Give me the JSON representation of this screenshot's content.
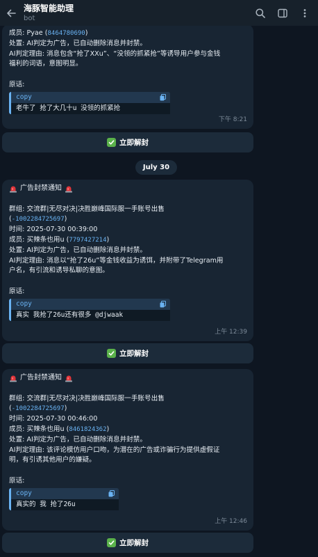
{
  "header": {
    "title": "海豚智能助理",
    "subtitle": "bot"
  },
  "date_separator": "July 30",
  "messages": [
    {
      "lines": {
        "member_label": "成员: Pyae (",
        "member_id": "8464780690",
        "member_suffix": ")",
        "action": "处置: AI判定为广告，已自动删除消息并封禁。",
        "reason_1": "AI判定理由: 消息包含“抢了XXu”、“没领的抓紧抢”等诱导用户参与金钱",
        "reason_2": "福利的词语，意图明显。",
        "original_label": "原话:"
      },
      "code": {
        "lang": "copy",
        "text": "老牛了 抢了大几十u 没领的抓紧抢"
      },
      "time": "下午 8:21"
    },
    {
      "lines": {
        "notice_title": "广告封禁通知",
        "group": "群组: 交流群|无尽对决|决胜巅峰国际服一手账号出售",
        "group_id": "-1002284725697",
        "time_line": "时间: 2025-07-30 00:39:00",
        "member_label": "成员: 买辣条也用u (",
        "member_id": "7797427214",
        "member_suffix": ")",
        "action": "处置: AI判定为广告，已自动删除消息并封禁。",
        "reason_1": "AI判定理由: 消息以“抢了26u”等金钱收益为诱饵，并附带了Telegram用",
        "reason_2": "户名，有引流和诱导私聊的意图。",
        "original_label": "原话:"
      },
      "code": {
        "lang": "copy",
        "text": "真实 我抢了26u还有很多 @djwaak"
      },
      "time": "上午 12:39"
    },
    {
      "lines": {
        "notice_title": "广告封禁通知",
        "group": "群组: 交流群|无尽对决|决胜巅峰国际服一手账号出售",
        "group_id": "-1002284725697",
        "time_line": "时间: 2025-07-30 00:46:00",
        "member_label": "成员: 买辣条也用u (",
        "member_id": "8461824362",
        "member_suffix": ")",
        "action": "处置: AI判定为广告，已自动删除消息并封禁。",
        "reason_1": "AI判定理由: 该评论模仿用户口吻，为潜在的广告或诈骗行为提供虚假证",
        "reason_2": "明，有引诱其他用户的嫌疑。",
        "original_label": "原话:"
      },
      "code": {
        "lang": "copy",
        "text": "真实的 我 抢了26u"
      },
      "time": "上午 12:46"
    }
  ],
  "unban_label": "立即解封",
  "colors": {
    "background": "#0e1621",
    "bubble": "#182533",
    "header": "#17212b",
    "link": "#6ab3f3",
    "check": "#5ab14a"
  },
  "icons": [
    "back-arrow-icon",
    "search-icon",
    "sidebar-toggle-icon",
    "more-vertical-icon",
    "siren-icon",
    "copy-icon",
    "check-mark-icon"
  ]
}
